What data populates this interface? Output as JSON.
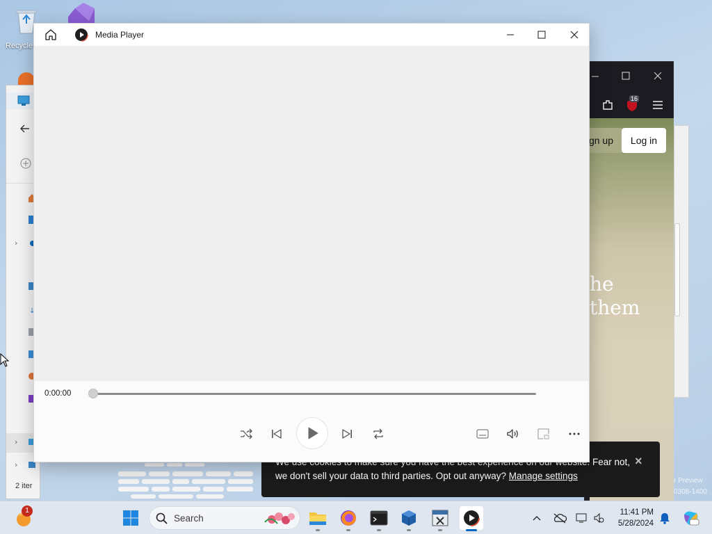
{
  "desktop": {
    "recycle_bin_label": "Recycle"
  },
  "explorer": {
    "status_text": "2 iter"
  },
  "browser": {
    "badge_count": "16",
    "signup_label": "ign up",
    "login_label": "Log in",
    "headline_line1": "he",
    "headline_line2": "them"
  },
  "watermark": {
    "line1": "r Preview",
    "line2": "0308-1400"
  },
  "cookie_banner": {
    "line1": "We use cookies to make sure you have the best experience on our website. Fear not,",
    "line2_text": "we don't sell your data to third parties. Opt out anyway? ",
    "manage_link": "Manage settings",
    "close_label": "×"
  },
  "player": {
    "title": "Media Player",
    "current_time": "0:00:00",
    "progress": 0,
    "accent_color": "#1a1a1a"
  },
  "taskbar": {
    "search_placeholder": "Search",
    "notification_badge": "1",
    "time": "11:41 PM",
    "date": "5/28/2024"
  }
}
